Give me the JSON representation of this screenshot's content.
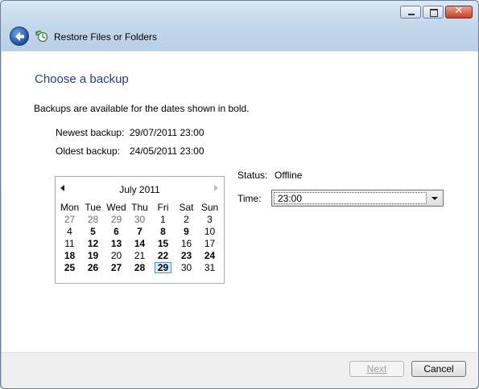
{
  "window": {
    "title": "Restore Files or Folders",
    "controls": {
      "close_glyph": "✕"
    }
  },
  "page": {
    "heading": "Choose a backup",
    "intro": "Backups are available for the dates shown in bold.",
    "newest_label": "Newest backup:",
    "newest_value": "29/07/2011 23:00",
    "oldest_label": "Oldest backup:",
    "oldest_value": "24/05/2011 23:00"
  },
  "calendar": {
    "month_label": "July 2011",
    "weekdays": [
      "Mon",
      "Tue",
      "Wed",
      "Thu",
      "Fri",
      "Sat",
      "Sun"
    ],
    "weeks": [
      [
        {
          "d": "27",
          "o": 1
        },
        {
          "d": "28",
          "o": 1
        },
        {
          "d": "29",
          "o": 1
        },
        {
          "d": "30",
          "o": 1
        },
        {
          "d": "1"
        },
        {
          "d": "2"
        },
        {
          "d": "3"
        }
      ],
      [
        {
          "d": "4"
        },
        {
          "d": "5",
          "b": 1
        },
        {
          "d": "6",
          "b": 1
        },
        {
          "d": "7",
          "b": 1
        },
        {
          "d": "8",
          "b": 1
        },
        {
          "d": "9",
          "b": 1
        },
        {
          "d": "10"
        }
      ],
      [
        {
          "d": "11"
        },
        {
          "d": "12",
          "b": 1
        },
        {
          "d": "13",
          "b": 1
        },
        {
          "d": "14",
          "b": 1
        },
        {
          "d": "15",
          "b": 1
        },
        {
          "d": "16"
        },
        {
          "d": "17"
        }
      ],
      [
        {
          "d": "18",
          "b": 1
        },
        {
          "d": "19",
          "b": 1
        },
        {
          "d": "20"
        },
        {
          "d": "21"
        },
        {
          "d": "22",
          "b": 1
        },
        {
          "d": "23",
          "b": 1
        },
        {
          "d": "24",
          "b": 1
        }
      ],
      [
        {
          "d": "25",
          "b": 1
        },
        {
          "d": "26",
          "b": 1
        },
        {
          "d": "27",
          "b": 1
        },
        {
          "d": "28",
          "b": 1
        },
        {
          "d": "29",
          "b": 1,
          "s": 1
        },
        {
          "d": "30"
        },
        {
          "d": "31"
        }
      ]
    ]
  },
  "status": {
    "label": "Status:",
    "value": "Offline"
  },
  "time": {
    "label": "Time:",
    "value": "23:00"
  },
  "buttons": {
    "next": "Next",
    "cancel": "Cancel"
  },
  "colors": {
    "heading": "#1e3f8e",
    "accent": "#5e8ecf"
  }
}
